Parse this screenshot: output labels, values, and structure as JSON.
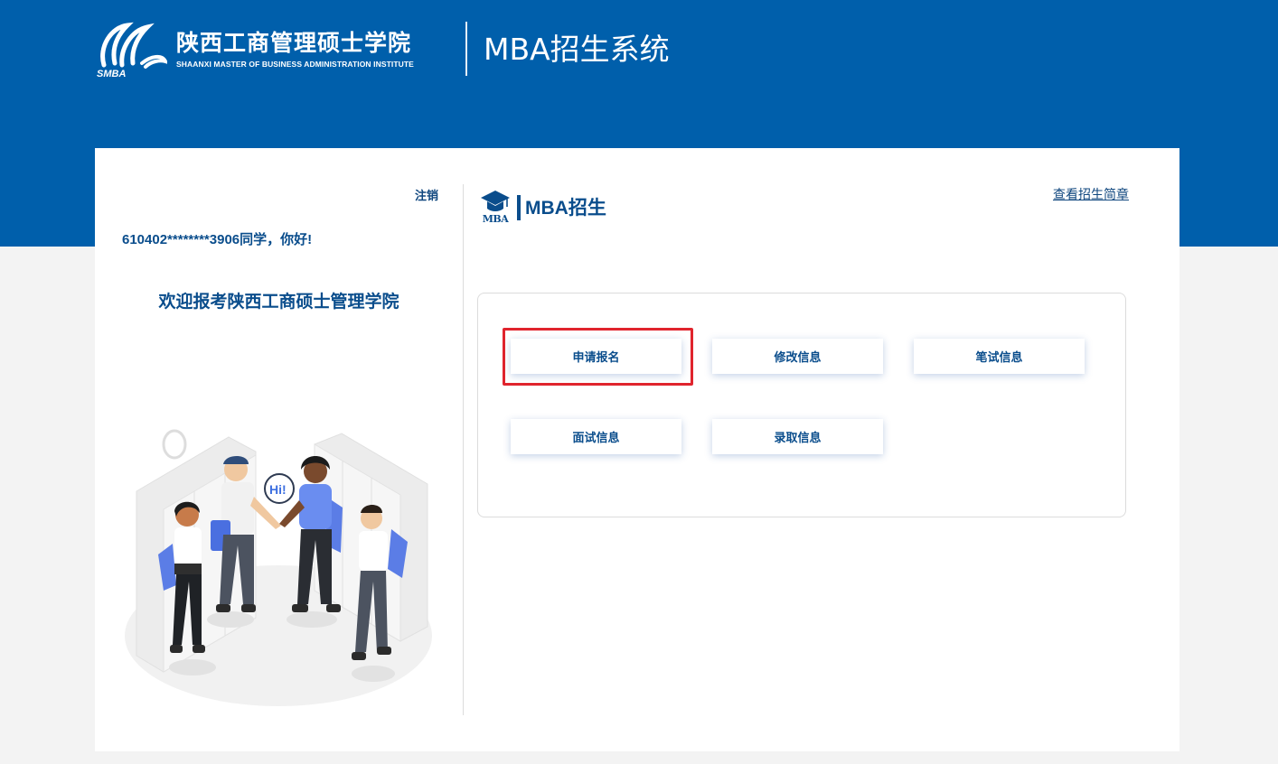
{
  "header": {
    "school_name_cn": "陕西工商管理硕士学院",
    "school_name_en": "SHAANXI MASTER OF BUSINESS ADMINISTRATION  INSTITUTE",
    "logo_abbr": "SMBA",
    "system_title": "MBA招生系统"
  },
  "user_panel": {
    "logout_label": "注销",
    "greeting": "610402********3906同学，你好!",
    "welcome": "欢迎报考陕西工商硕士管理学院",
    "illustration_speech": "Hi!"
  },
  "main": {
    "section_icon_label": "MBA",
    "section_title": "MBA招生",
    "brochure_link": "查看招生简章",
    "actions": [
      {
        "label": "申请报名",
        "highlighted": true
      },
      {
        "label": "修改信息"
      },
      {
        "label": "笔试信息"
      },
      {
        "label": "面试信息"
      },
      {
        "label": "录取信息"
      }
    ],
    "highlight_color": "#e0242d"
  },
  "colors": {
    "header_bg": "#005fab",
    "accent_text": "#0a4d8c"
  }
}
